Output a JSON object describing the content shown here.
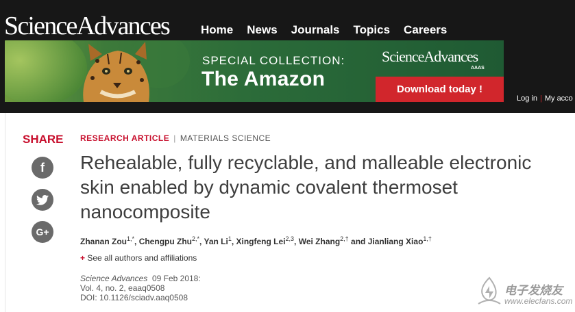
{
  "header": {
    "logo": "ScienceAdvances",
    "nav": [
      "Home",
      "News",
      "Journals",
      "Topics",
      "Careers"
    ],
    "user_links": {
      "login": "Log in",
      "account": "My acco"
    }
  },
  "banner": {
    "kicker": "SPECIAL COLLECTION:",
    "title": "The Amazon",
    "logo": "ScienceAdvances",
    "logo_sub": "AAAS",
    "button": "Download today !"
  },
  "share": {
    "label": "SHARE",
    "icons": [
      "facebook-icon",
      "twitter-icon",
      "google-plus-icon"
    ]
  },
  "article": {
    "type": "RESEARCH ARTICLE",
    "category": "MATERIALS SCIENCE",
    "title": "Rehealable, fully recyclable, and malleable electronic skin enabled by dynamic covalent thermoset nanocomposite",
    "authors": [
      {
        "name": "Zhanan Zou",
        "sup": "1,*"
      },
      {
        "name": "Chengpu Zhu",
        "sup": "2,*"
      },
      {
        "name": "Yan Li",
        "sup": "1"
      },
      {
        "name": "Xingfeng Lei",
        "sup": "2,3"
      },
      {
        "name": "Wei Zhang",
        "sup": "2,†"
      },
      {
        "name": "Jianliang Xiao",
        "sup": "1,†"
      }
    ],
    "authors_and": "and",
    "see_all": "See all authors and affiliations",
    "journal": "Science Advances",
    "date": "09 Feb 2018:",
    "volume": "Vol. 4, no. 2, eaaq0508",
    "doi": "DOI: 10.1126/sciadv.aaq0508"
  },
  "watermark": {
    "text": "电子发烧友",
    "url": "www.elecfans.com"
  },
  "colors": {
    "brand_red": "#c8102e",
    "header_bg": "#171717",
    "button_red": "#d1262c",
    "share_grey": "#6a6a6a"
  }
}
